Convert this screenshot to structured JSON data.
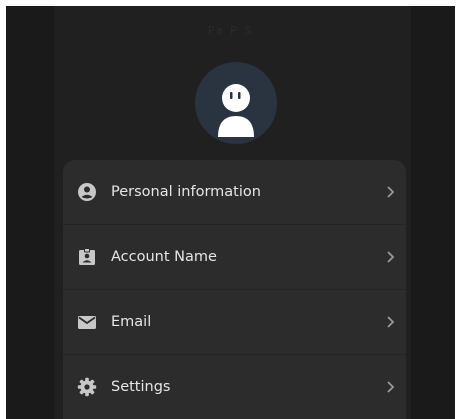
{
  "window": {
    "title_text": "Pa  P  S"
  },
  "avatar": {
    "icon": "user-avatar-icon"
  },
  "menu": {
    "items": [
      {
        "label": "Personal information",
        "icon": "account-circle-icon"
      },
      {
        "label": "Account Name",
        "icon": "badge-icon"
      },
      {
        "label": "Email",
        "icon": "mail-icon"
      },
      {
        "label": "Settings",
        "icon": "gear-icon"
      }
    ]
  },
  "colors": {
    "background": "#202020",
    "card": "#2c2c2c",
    "text": "#e6e6e6",
    "icon": "#c8c8c8",
    "avatar_bg": "#2a3340"
  }
}
